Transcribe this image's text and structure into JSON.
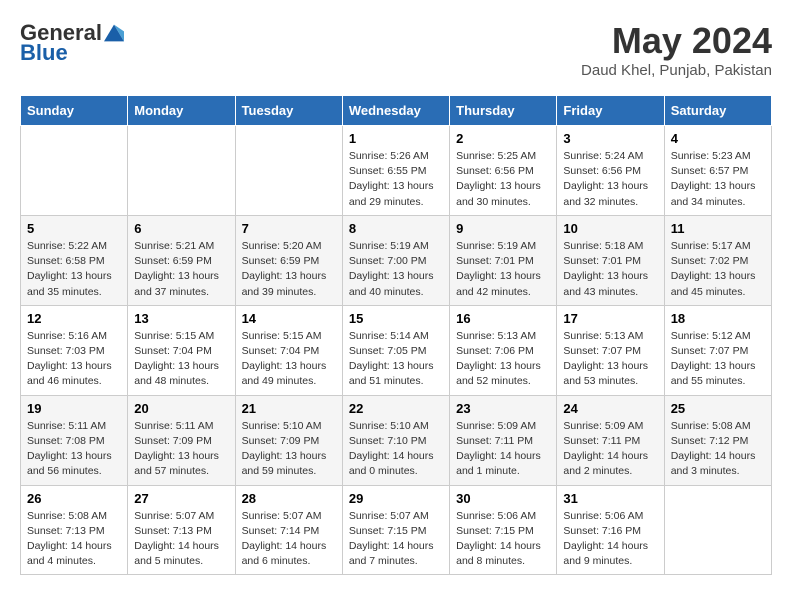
{
  "logo": {
    "general": "General",
    "blue": "Blue"
  },
  "title": "May 2024",
  "location": "Daud Khel, Punjab, Pakistan",
  "days_header": [
    "Sunday",
    "Monday",
    "Tuesday",
    "Wednesday",
    "Thursday",
    "Friday",
    "Saturday"
  ],
  "weeks": [
    [
      {
        "day": "",
        "info": ""
      },
      {
        "day": "",
        "info": ""
      },
      {
        "day": "",
        "info": ""
      },
      {
        "day": "1",
        "info": "Sunrise: 5:26 AM\nSunset: 6:55 PM\nDaylight: 13 hours\nand 29 minutes."
      },
      {
        "day": "2",
        "info": "Sunrise: 5:25 AM\nSunset: 6:56 PM\nDaylight: 13 hours\nand 30 minutes."
      },
      {
        "day": "3",
        "info": "Sunrise: 5:24 AM\nSunset: 6:56 PM\nDaylight: 13 hours\nand 32 minutes."
      },
      {
        "day": "4",
        "info": "Sunrise: 5:23 AM\nSunset: 6:57 PM\nDaylight: 13 hours\nand 34 minutes."
      }
    ],
    [
      {
        "day": "5",
        "info": "Sunrise: 5:22 AM\nSunset: 6:58 PM\nDaylight: 13 hours\nand 35 minutes."
      },
      {
        "day": "6",
        "info": "Sunrise: 5:21 AM\nSunset: 6:59 PM\nDaylight: 13 hours\nand 37 minutes."
      },
      {
        "day": "7",
        "info": "Sunrise: 5:20 AM\nSunset: 6:59 PM\nDaylight: 13 hours\nand 39 minutes."
      },
      {
        "day": "8",
        "info": "Sunrise: 5:19 AM\nSunset: 7:00 PM\nDaylight: 13 hours\nand 40 minutes."
      },
      {
        "day": "9",
        "info": "Sunrise: 5:19 AM\nSunset: 7:01 PM\nDaylight: 13 hours\nand 42 minutes."
      },
      {
        "day": "10",
        "info": "Sunrise: 5:18 AM\nSunset: 7:01 PM\nDaylight: 13 hours\nand 43 minutes."
      },
      {
        "day": "11",
        "info": "Sunrise: 5:17 AM\nSunset: 7:02 PM\nDaylight: 13 hours\nand 45 minutes."
      }
    ],
    [
      {
        "day": "12",
        "info": "Sunrise: 5:16 AM\nSunset: 7:03 PM\nDaylight: 13 hours\nand 46 minutes."
      },
      {
        "day": "13",
        "info": "Sunrise: 5:15 AM\nSunset: 7:04 PM\nDaylight: 13 hours\nand 48 minutes."
      },
      {
        "day": "14",
        "info": "Sunrise: 5:15 AM\nSunset: 7:04 PM\nDaylight: 13 hours\nand 49 minutes."
      },
      {
        "day": "15",
        "info": "Sunrise: 5:14 AM\nSunset: 7:05 PM\nDaylight: 13 hours\nand 51 minutes."
      },
      {
        "day": "16",
        "info": "Sunrise: 5:13 AM\nSunset: 7:06 PM\nDaylight: 13 hours\nand 52 minutes."
      },
      {
        "day": "17",
        "info": "Sunrise: 5:13 AM\nSunset: 7:07 PM\nDaylight: 13 hours\nand 53 minutes."
      },
      {
        "day": "18",
        "info": "Sunrise: 5:12 AM\nSunset: 7:07 PM\nDaylight: 13 hours\nand 55 minutes."
      }
    ],
    [
      {
        "day": "19",
        "info": "Sunrise: 5:11 AM\nSunset: 7:08 PM\nDaylight: 13 hours\nand 56 minutes."
      },
      {
        "day": "20",
        "info": "Sunrise: 5:11 AM\nSunset: 7:09 PM\nDaylight: 13 hours\nand 57 minutes."
      },
      {
        "day": "21",
        "info": "Sunrise: 5:10 AM\nSunset: 7:09 PM\nDaylight: 13 hours\nand 59 minutes."
      },
      {
        "day": "22",
        "info": "Sunrise: 5:10 AM\nSunset: 7:10 PM\nDaylight: 14 hours\nand 0 minutes."
      },
      {
        "day": "23",
        "info": "Sunrise: 5:09 AM\nSunset: 7:11 PM\nDaylight: 14 hours\nand 1 minute."
      },
      {
        "day": "24",
        "info": "Sunrise: 5:09 AM\nSunset: 7:11 PM\nDaylight: 14 hours\nand 2 minutes."
      },
      {
        "day": "25",
        "info": "Sunrise: 5:08 AM\nSunset: 7:12 PM\nDaylight: 14 hours\nand 3 minutes."
      }
    ],
    [
      {
        "day": "26",
        "info": "Sunrise: 5:08 AM\nSunset: 7:13 PM\nDaylight: 14 hours\nand 4 minutes."
      },
      {
        "day": "27",
        "info": "Sunrise: 5:07 AM\nSunset: 7:13 PM\nDaylight: 14 hours\nand 5 minutes."
      },
      {
        "day": "28",
        "info": "Sunrise: 5:07 AM\nSunset: 7:14 PM\nDaylight: 14 hours\nand 6 minutes."
      },
      {
        "day": "29",
        "info": "Sunrise: 5:07 AM\nSunset: 7:15 PM\nDaylight: 14 hours\nand 7 minutes."
      },
      {
        "day": "30",
        "info": "Sunrise: 5:06 AM\nSunset: 7:15 PM\nDaylight: 14 hours\nand 8 minutes."
      },
      {
        "day": "31",
        "info": "Sunrise: 5:06 AM\nSunset: 7:16 PM\nDaylight: 14 hours\nand 9 minutes."
      },
      {
        "day": "",
        "info": ""
      }
    ]
  ]
}
